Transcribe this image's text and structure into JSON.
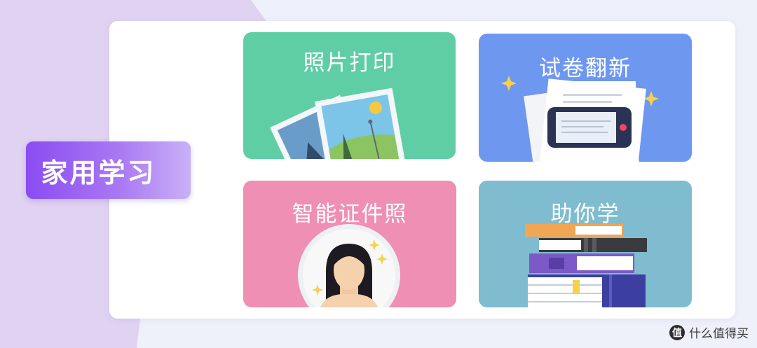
{
  "category": {
    "label": "家用学习"
  },
  "cards": [
    {
      "label": "照片打印",
      "illustration": "photo-prints-icon"
    },
    {
      "label": "试卷翻新",
      "illustration": "scanned-document-icon"
    },
    {
      "label": "智能证件照",
      "illustration": "id-photo-portrait-icon"
    },
    {
      "label": "助你学",
      "illustration": "book-stack-icon"
    }
  ],
  "watermark": {
    "logo": "值",
    "text": "什么值得买"
  },
  "colors": {
    "photo_card": "#5fcea5",
    "exam_card": "#6e97f0",
    "id_card": "#ef8fb3",
    "study_card": "#7fbccf",
    "badge_accent": "#8a4cf2"
  }
}
